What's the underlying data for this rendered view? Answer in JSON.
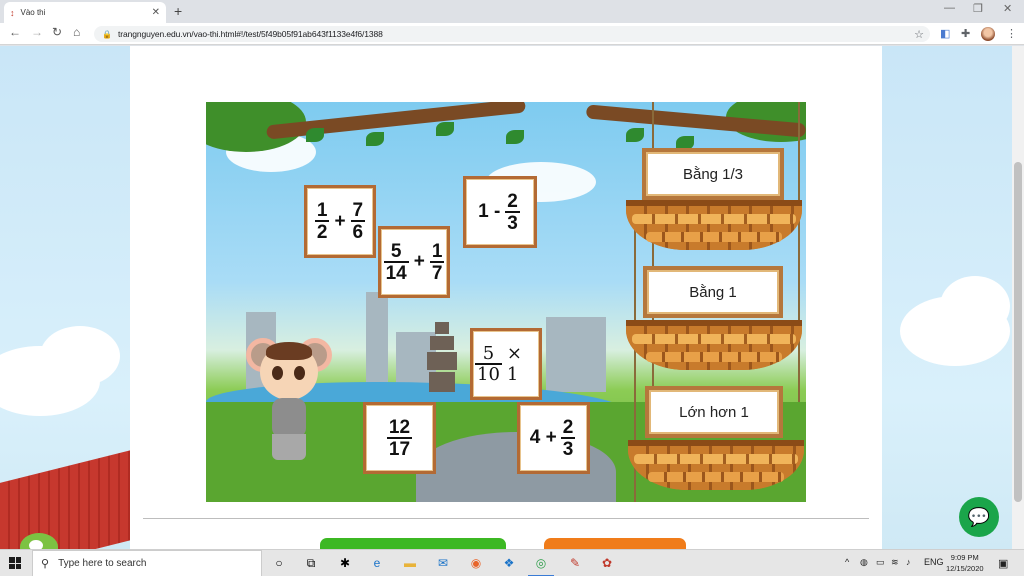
{
  "browser": {
    "tab_title": "Vào thi",
    "url": "trangnguyen.edu.vn/vao-thi.html#!/test/5f49b05f91ab643f1133e4f6/1388"
  },
  "game": {
    "cards": [
      {
        "id": "card-1",
        "parts": [
          "1/2",
          "+",
          "7/6"
        ]
      },
      {
        "id": "card-2",
        "parts": [
          "5/14",
          "+",
          "1/7"
        ]
      },
      {
        "id": "card-3",
        "parts": [
          "1 -",
          "2/3"
        ]
      },
      {
        "id": "card-4",
        "parts": [
          "5/10",
          "× 1"
        ]
      },
      {
        "id": "card-5",
        "parts": [
          "12/17"
        ]
      },
      {
        "id": "card-6",
        "parts": [
          "4 +",
          "2/3"
        ]
      }
    ],
    "baskets": [
      {
        "label": "Bằng 1/3"
      },
      {
        "label": "Bằng 1"
      },
      {
        "label": "Lớn hơn 1"
      }
    ]
  },
  "taskbar": {
    "search_placeholder": "Type here to search",
    "language": "ENG",
    "time": "9:09 PM",
    "date": "12/15/2020"
  },
  "colors": {
    "card_border": "#b36a34",
    "basket": "#c87b2c",
    "green_button": "#3cb823",
    "orange_button": "#f07c1a",
    "chat": "#1aa54a"
  }
}
